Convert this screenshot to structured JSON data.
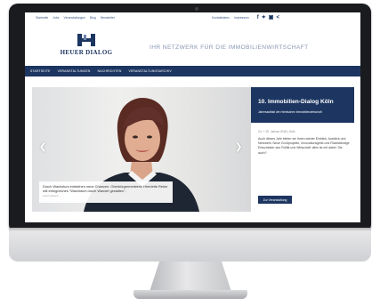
{
  "topbar": {
    "links": [
      "Startseite",
      "Jobs",
      "Veranstaltungen",
      "Blog",
      "Newsletter"
    ],
    "right_links": [
      "Kontaktdaten",
      "Impressum"
    ]
  },
  "social_icons": [
    "facebook-icon",
    "twitter-icon",
    "youtube-icon",
    "share-icon"
  ],
  "brand": {
    "name": "HEUER DIALOG",
    "mark": "H",
    "color": "#1d3661"
  },
  "tagline": "IHR NETZWERK FÜR DIE IMMOBILIENWIRTSCHAFT",
  "nav": {
    "items": [
      "STARTSEITE",
      "VERANSTALTUNGEN",
      "NACHRICHTEN",
      "VERANSTALTUNGSARCHIV"
    ]
  },
  "hero": {
    "caption": "Durch Wachstum entstehen neue Chancen. Oberbürgermeisterin Henriette Reker will erfolgreiches \"Wachstum durch Wandel gestalten\".",
    "credit": "Lorem Ipsum",
    "prev_icon": "chevron-left-icon",
    "next_icon": "chevron-right-icon"
  },
  "event": {
    "title": "10. Immobilien-Dialog Köln",
    "subtitle": "Jahresauftakt der rheinischen Immobilienwirtschaft",
    "date": "24. + 25. Januar 2018 | Köln",
    "body": "Auch dieses Jahr bieten wir Ihnen wieder Einblick, Ausblick und Netzwerk. Neue Großprojekte, Innovationsgeist und Rückständige Entscheider aus Politik und Wirtschaft: alles ist mit dabei. Sie auch?",
    "button": "Zur Veranstaltung"
  }
}
